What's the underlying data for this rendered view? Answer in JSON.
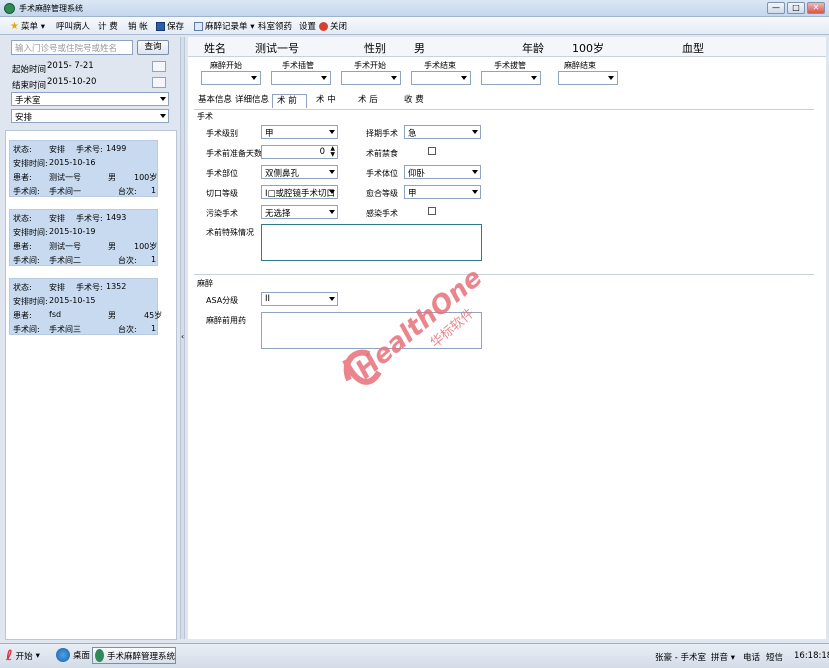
{
  "window": {
    "title": "手术麻醉管理系统",
    "min": "—",
    "max": "□",
    "close": "✕"
  },
  "menu": [
    {
      "label": "菜单 ▾",
      "icon": "star-icon"
    },
    {
      "label": "呼叫病人",
      "icon": ""
    },
    {
      "label": "计 费",
      "icon": ""
    },
    {
      "label": "销 帐",
      "icon": ""
    },
    {
      "label": "保存",
      "icon": "save-icon"
    },
    {
      "label": "麻醉记录单 ▾",
      "icon": "record-icon"
    },
    {
      "label": "科室领药",
      "icon": ""
    },
    {
      "label": "设置",
      "icon": ""
    },
    {
      "label": "关闭",
      "icon": "close-icon"
    }
  ],
  "search": {
    "placeholder": "输入门诊号或住院号或姓名",
    "button": "查询"
  },
  "filters": {
    "start_label": "起始时间",
    "start_value": "2015- 7-21",
    "end_label": "结束时间",
    "end_value": "2015-10-20",
    "room": "手术室",
    "status": "安排"
  },
  "patients": [
    {
      "status_label": "状态:",
      "status": "安排",
      "no_label": "手术号:",
      "no": "1499",
      "time_label": "安排时间:",
      "time": "2015-10-16",
      "patient_label": "患者:",
      "patient": "测试一号",
      "sex": "男",
      "age": "100岁",
      "room_label": "手术间:",
      "room": "手术间一",
      "seq_label": "台次:",
      "seq": "1"
    },
    {
      "status_label": "状态:",
      "status": "安排",
      "no_label": "手术号:",
      "no": "1493",
      "time_label": "安排时间:",
      "time": "2015-10-19",
      "patient_label": "患者:",
      "patient": "测试一号",
      "sex": "男",
      "age": "100岁",
      "room_label": "手术间:",
      "room": "手术间二",
      "seq_label": "台次:",
      "seq": "1"
    },
    {
      "status_label": "状态:",
      "status": "安排",
      "no_label": "手术号:",
      "no": "1352",
      "time_label": "安排时间:",
      "time": "2015-10-15",
      "patient_label": "患者:",
      "patient": "fsd",
      "sex": "男",
      "age": "45岁",
      "room_label": "手术间:",
      "room": "手术间三",
      "seq_label": "台次:",
      "seq": "1"
    }
  ],
  "header": {
    "name_label": "姓名",
    "name": "测试一号",
    "sex_label": "性别",
    "sex": "男",
    "age_label": "年龄",
    "age": "100岁",
    "blood_label": "血型"
  },
  "timeline": [
    "麻醉开始",
    "手术插管",
    "手术开始",
    "手术结束",
    "手术拔管",
    "麻醉结束"
  ],
  "tabs": [
    "基本信息",
    "详细信息",
    "术 前",
    "术 中",
    "术 后",
    "收 费"
  ],
  "surgery": {
    "title": "手术",
    "level_label": "手术级别",
    "level": "甲",
    "period_label": "择期手术",
    "period": "急",
    "fast_label": "手术前准备天数",
    "fast": "0",
    "fee_label": "术前禁食",
    "site_label": "手术部位",
    "site": "双侧鼻孔",
    "position_label": "手术体位",
    "position": "仰卧",
    "incision_label": "切口等级",
    "incision": "I□或腔镜手术切口",
    "heal_label": "愈合等级",
    "heal": "甲",
    "infect_label": "污染手术",
    "infect": "无选择",
    "infect2_label": "感染手术",
    "special_label": "术前特殊情况"
  },
  "anesthesia": {
    "title": "麻醉",
    "asa_label": "ASA分级",
    "asa": "II",
    "pre_label": "麻醉前用药"
  },
  "taskbar": {
    "start": "开始",
    "desktop": "桌面",
    "app": "手术麻醉管理系统",
    "user": "张豪 - 手术室",
    "ime": "拼音 ▾",
    "phone": "电话",
    "sms": "短信",
    "clock": "16:18:18"
  },
  "watermark": {
    "brand": "HealthOne",
    "company": "华标软件"
  },
  "colors": {
    "accent": "#c7daf0",
    "brand_red": "#e0313a"
  }
}
